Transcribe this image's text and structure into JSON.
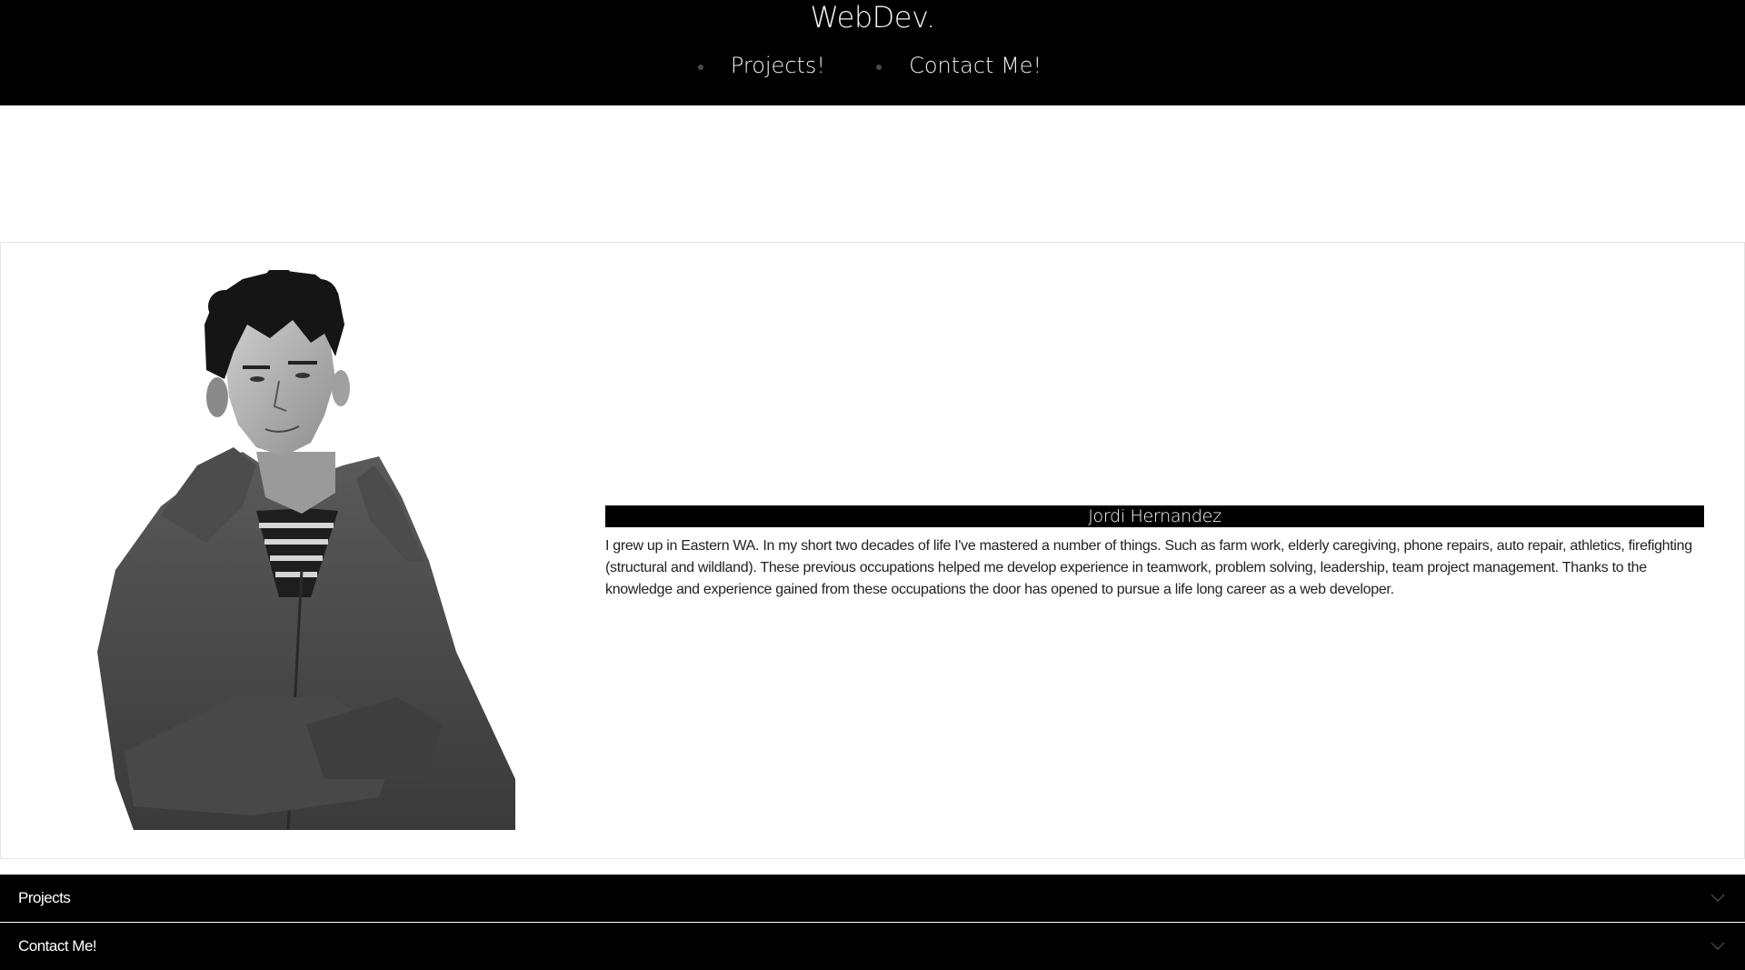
{
  "header": {
    "title": "WebDev.",
    "nav": [
      {
        "label": "Projects!"
      },
      {
        "label": "Contact Me!"
      }
    ]
  },
  "about": {
    "name": "Jordi Hernandez",
    "bio": "I grew up in Eastern WA. In my short two decades of life I've mastered a number of things. Such as farm work, elderly caregiving, phone repairs, auto repair, athletics, firefighting (structural and wildland). These previous occupations helped me develop experience in teamwork, problem solving, leadership, team project management. Thanks to the knowledge and experience gained from these occupations the door has opened to pursue a life long career as a web developer.",
    "portrait_icon": "portrait-photo"
  },
  "accordions": [
    {
      "label": "Projects",
      "icon": "chevron-down-icon"
    },
    {
      "label": "Contact Me!",
      "icon": "chevron-down-icon"
    }
  ],
  "colors": {
    "header_bg": "#000000",
    "text_light": "#f2f2f2",
    "accordion_bg": "#000000"
  }
}
